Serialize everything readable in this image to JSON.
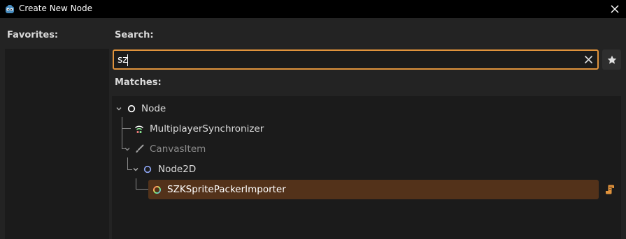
{
  "window": {
    "title": "Create New Node",
    "icons": {
      "app": "godot-icon",
      "close": "close-icon"
    }
  },
  "favorites": {
    "label": "Favorites:"
  },
  "search": {
    "label": "Search:",
    "value": "sz",
    "clear_icon": "clear-icon",
    "favorite_icon": "star-icon"
  },
  "matches": {
    "label": "Matches:",
    "items": [
      {
        "label": "Node",
        "icon": "node-icon",
        "disabled": false
      },
      {
        "label": "MultiplayerSynchronizer",
        "icon": "multiplayer-synchronizer-icon",
        "disabled": false
      },
      {
        "label": "CanvasItem",
        "icon": "brush-icon",
        "disabled": true
      },
      {
        "label": "Node2D",
        "icon": "node2d-icon",
        "disabled": false
      },
      {
        "label": "SZKSpritePackerImporter",
        "icon": "script-class-icon",
        "disabled": false,
        "selected": true
      }
    ],
    "script_icon": "script-icon"
  },
  "colors": {
    "accent": "#e0933c",
    "selection": "#53321a",
    "node2d_blue": "#8da5f3",
    "disabled_text": "#8c8c8c"
  }
}
